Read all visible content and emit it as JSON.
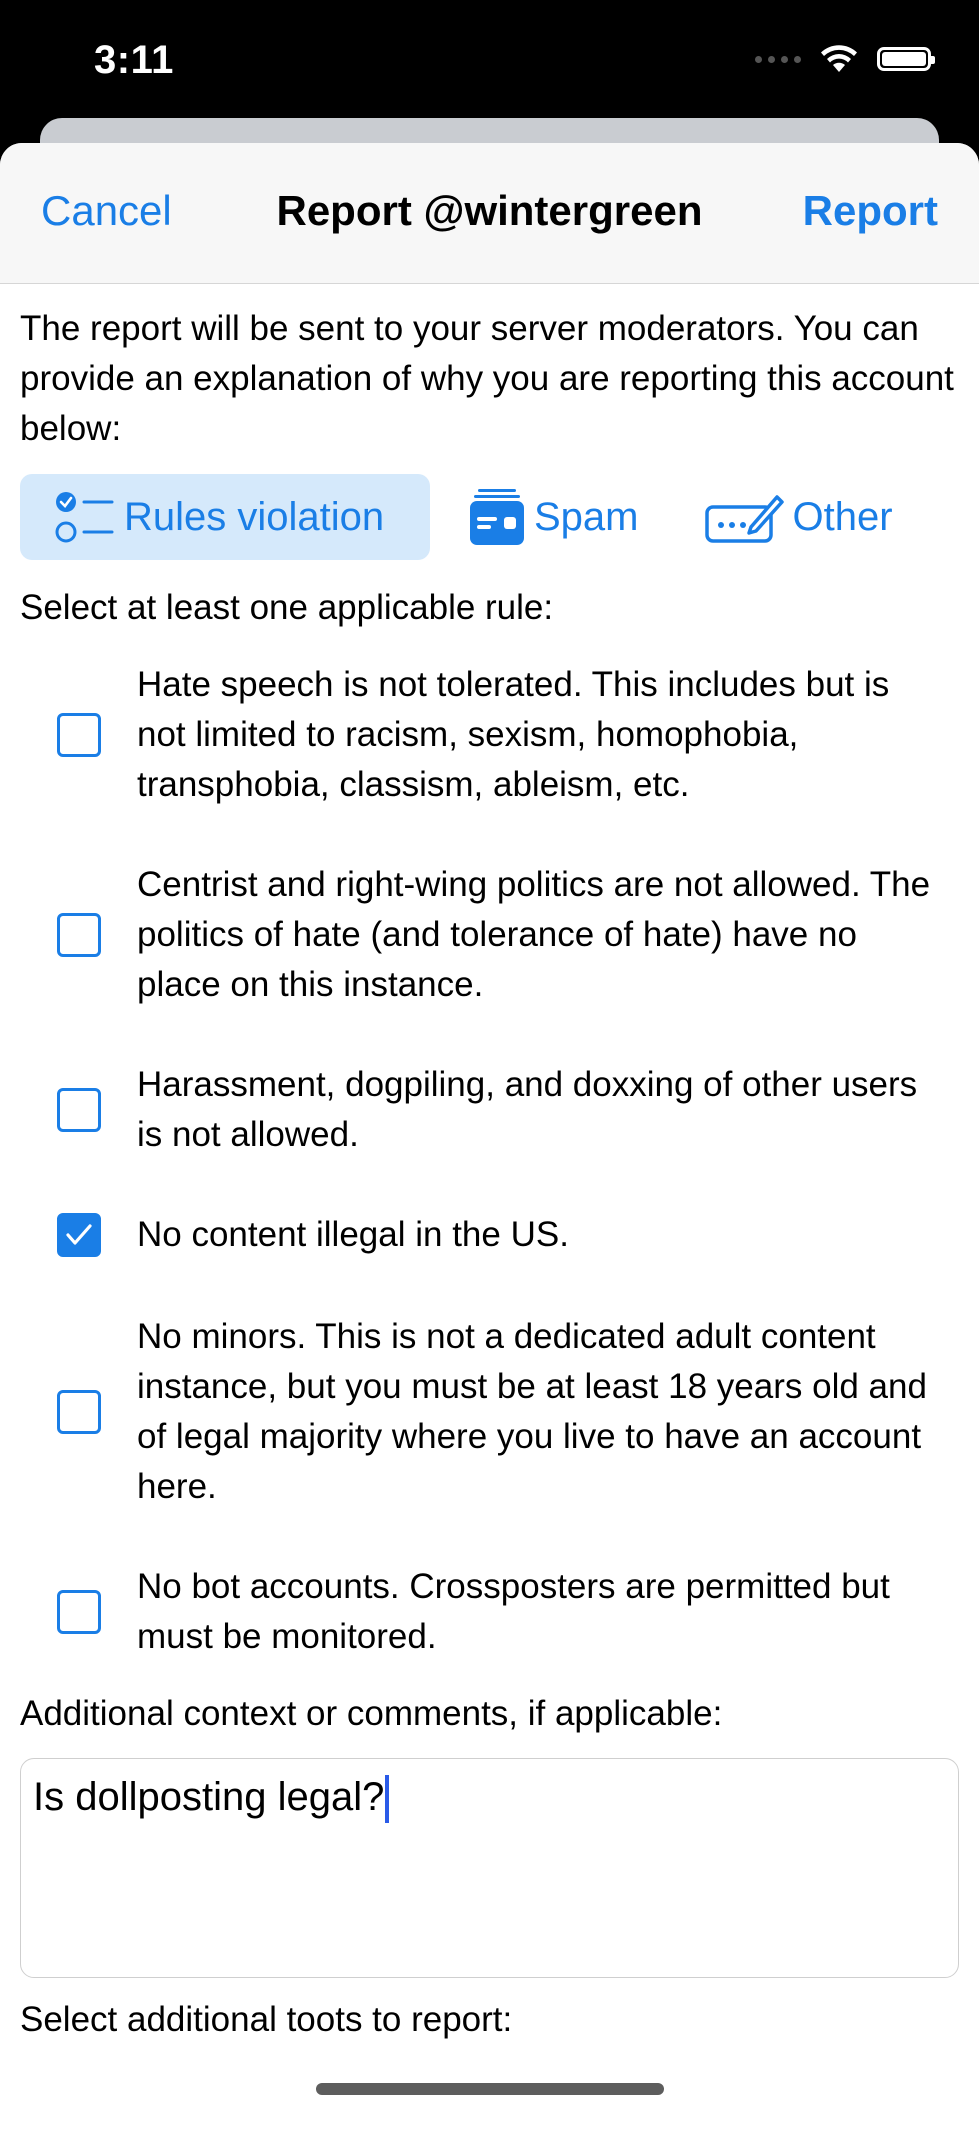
{
  "status": {
    "time": "3:11",
    "icons": [
      "cellular-icon",
      "wifi-icon",
      "battery-icon"
    ]
  },
  "nav": {
    "cancel": "Cancel",
    "title": "Report @wintergreen",
    "report": "Report"
  },
  "intro": "The report will be sent to your server moderators. You can provide an explanation of why you are reporting this account below:",
  "categories": [
    {
      "label": "Rules violation",
      "icon": "checklist-icon",
      "selected": true
    },
    {
      "label": "Spam",
      "icon": "spam-icon",
      "selected": false
    },
    {
      "label": "Other",
      "icon": "other-icon",
      "selected": false
    }
  ],
  "rules_label": "Select at least one applicable rule:",
  "rules": [
    {
      "text": "Hate speech is not tolerated. This includes but is not limited to racism, sexism, homophobia, transphobia, classism, ableism, etc.",
      "checked": false
    },
    {
      "text": "Centrist and right-wing politics are not allowed. The politics of hate (and tolerance of hate) have no place on this instance.",
      "checked": false
    },
    {
      "text": "Harassment, dogpiling, and doxxing of other users is not allowed.",
      "checked": false
    },
    {
      "text": "No content illegal in the US.",
      "checked": true
    },
    {
      "text": "No minors. This is not a dedicated adult content instance, but you must be at least 18 years old and of legal majority where you live to have an account here.",
      "checked": false
    },
    {
      "text": "No bot accounts. Crossposters are permitted but must be monitored.",
      "checked": false
    }
  ],
  "context_label": "Additional context or comments, if applicable:",
  "comment_value": "Is dollposting legal?",
  "more_label": "Select additional toots to report:",
  "colors": {
    "accent": "#1a7ee6",
    "selected_bg": "#d5e9fb",
    "caret": "#2a5be8"
  }
}
